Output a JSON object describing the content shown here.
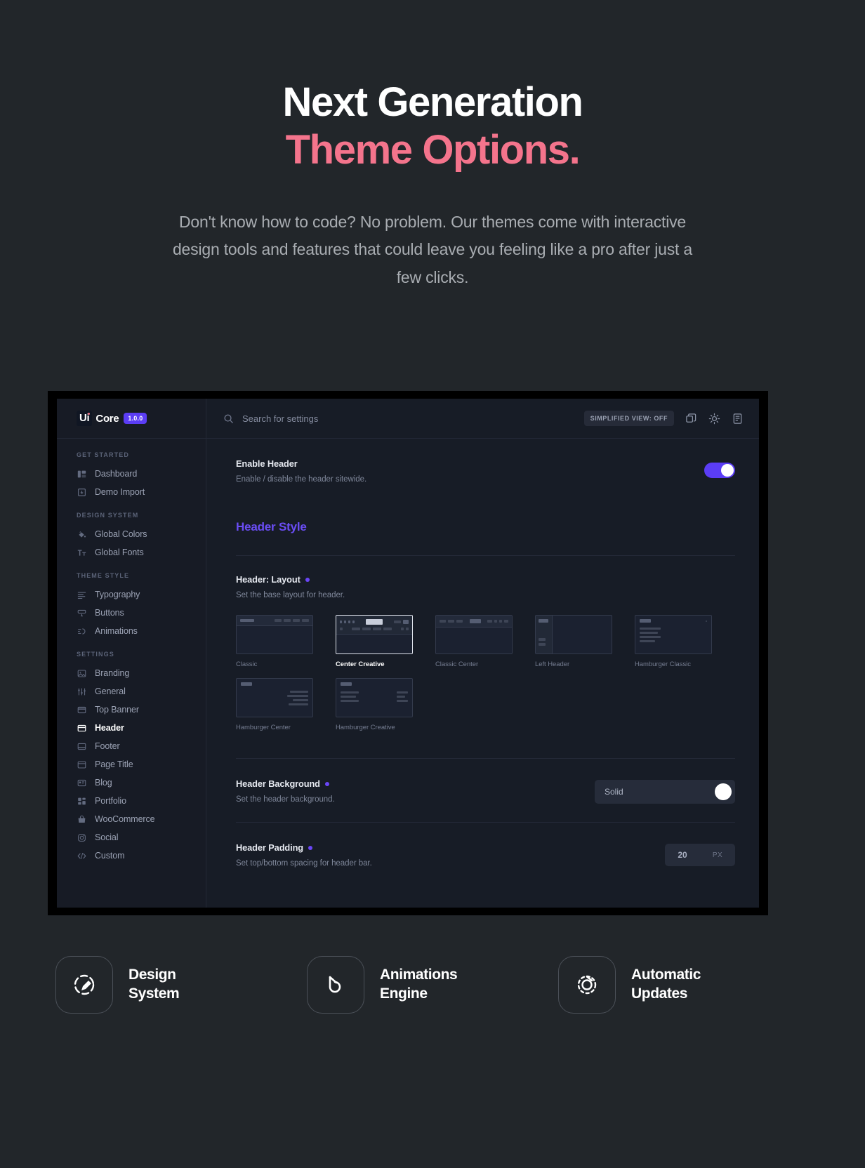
{
  "hero": {
    "title_line1": "Next Generation",
    "title_line2": "Theme Options.",
    "subtitle": "Don't know how to code? No problem. Our themes come with interactive design tools and features that could leave you feeling like a pro after just a few clicks.",
    "accent_color": "#f4748c"
  },
  "app": {
    "brand": {
      "mark": "Ui",
      "name": "Core",
      "version": "1.0.0"
    },
    "search": {
      "placeholder": "Search for settings",
      "value": ""
    },
    "topbar": {
      "simplified_badge": "SIMPLIFIED VIEW: OFF",
      "icons": [
        "copy-icon",
        "sun-icon",
        "document-icon"
      ]
    },
    "sidebar": {
      "groups": [
        {
          "title": "GET STARTED",
          "items": [
            {
              "label": "Dashboard",
              "icon": "dashboard-icon",
              "active": false
            },
            {
              "label": "Demo Import",
              "icon": "demo-import-icon",
              "active": false
            }
          ]
        },
        {
          "title": "DESIGN SYSTEM",
          "items": [
            {
              "label": "Global Colors",
              "icon": "paint-bucket-icon",
              "active": false
            },
            {
              "label": "Global Fonts",
              "icon": "font-size-icon",
              "active": false
            }
          ]
        },
        {
          "title": "THEME STYLE",
          "items": [
            {
              "label": "Typography",
              "icon": "text-lines-icon",
              "active": false
            },
            {
              "label": "Buttons",
              "icon": "button-icon",
              "active": false
            },
            {
              "label": "Animations",
              "icon": "animation-icon",
              "active": false
            }
          ]
        },
        {
          "title": "SETTINGS",
          "items": [
            {
              "label": "Branding",
              "icon": "image-icon",
              "active": false
            },
            {
              "label": "General",
              "icon": "sliders-icon",
              "active": false
            },
            {
              "label": "Top Banner",
              "icon": "top-banner-icon",
              "active": false
            },
            {
              "label": "Header",
              "icon": "header-icon",
              "active": true
            },
            {
              "label": "Footer",
              "icon": "footer-icon",
              "active": false
            },
            {
              "label": "Page Title",
              "icon": "page-title-icon",
              "active": false
            },
            {
              "label": "Blog",
              "icon": "blog-icon",
              "active": false
            },
            {
              "label": "Portfolio",
              "icon": "portfolio-icon",
              "active": false
            },
            {
              "label": "WooCommerce",
              "icon": "bag-icon",
              "active": false
            },
            {
              "label": "Social",
              "icon": "instagram-icon",
              "active": false
            },
            {
              "label": "Custom",
              "icon": "code-icon",
              "active": false
            }
          ]
        }
      ]
    },
    "settings": {
      "enable_header": {
        "title": "Enable Header",
        "description": "Enable / disable the header sitewide.",
        "toggle_on": true
      },
      "section_title": "Header Style",
      "header_layout": {
        "title": "Header: Layout",
        "description": "Set the base layout for header.",
        "options": [
          {
            "label": "Classic",
            "selected": false
          },
          {
            "label": "Center Creative",
            "selected": true
          },
          {
            "label": "Classic Center",
            "selected": false
          },
          {
            "label": "Left Header",
            "selected": false
          },
          {
            "label": "Hamburger Classic",
            "selected": false
          },
          {
            "label": "Hamburger Center",
            "selected": false
          },
          {
            "label": "Hamburger Creative",
            "selected": false
          }
        ]
      },
      "header_background": {
        "title": "Header Background",
        "description": "Set the header background.",
        "value": "Solid"
      },
      "header_padding": {
        "title": "Header Padding",
        "description": "Set top/bottom spacing for header bar.",
        "value": "20",
        "unit": "PX"
      }
    }
  },
  "features": [
    {
      "icon": "design-system-icon",
      "line1": "Design",
      "line2": "System"
    },
    {
      "icon": "animations-engine-icon",
      "line1": "Animations",
      "line2": "Engine"
    },
    {
      "icon": "automatic-updates-icon",
      "line1": "Automatic",
      "line2": "Updates"
    }
  ]
}
